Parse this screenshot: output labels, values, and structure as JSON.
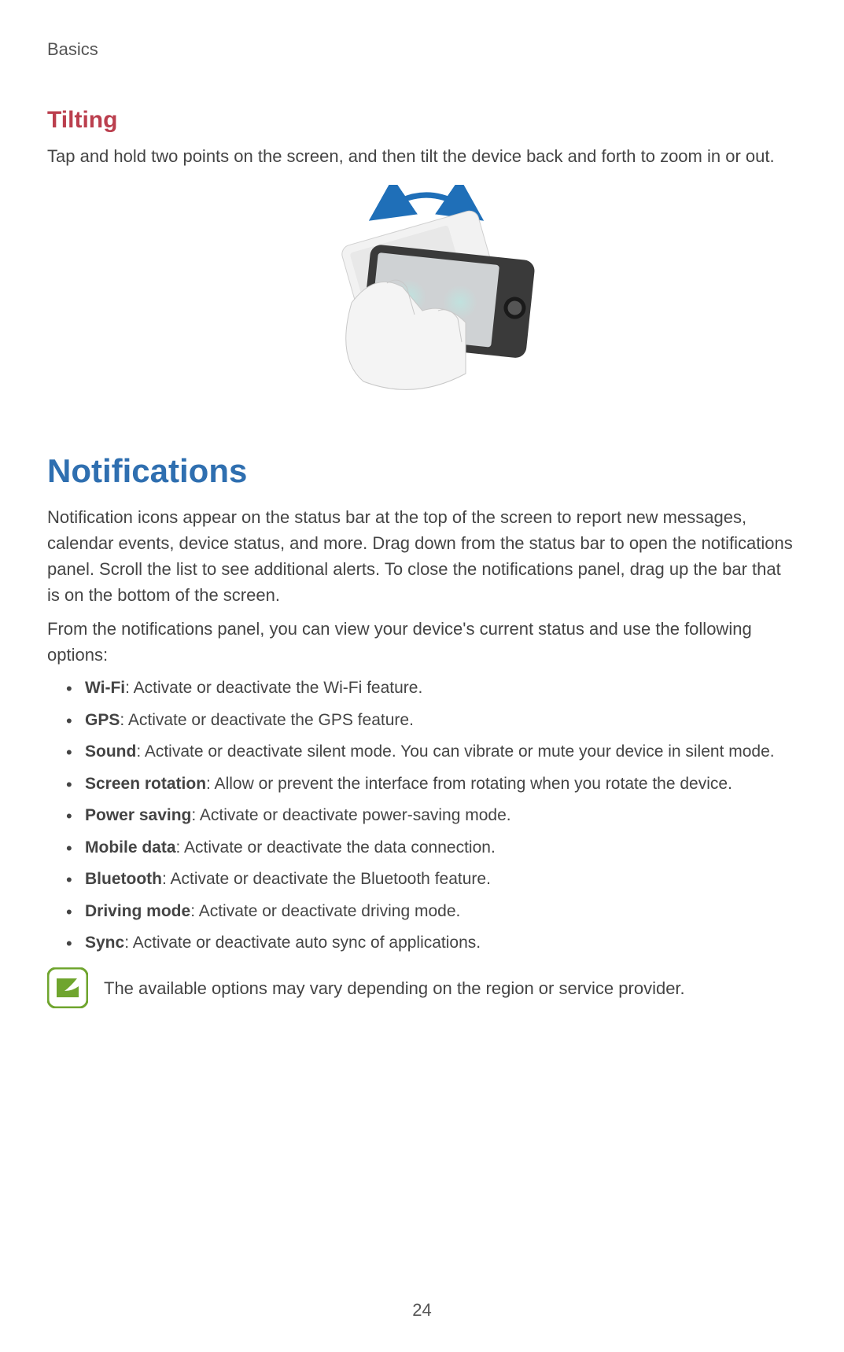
{
  "header": "Basics",
  "tilting": {
    "title": "Tilting",
    "body": "Tap and hold two points on the screen, and then tilt the device back and forth to zoom in or out."
  },
  "notifications": {
    "title": "Notifications",
    "para1": "Notification icons appear on the status bar at the top of the screen to report new messages, calendar events, device status, and more. Drag down from the status bar to open the notifications panel. Scroll the list to see additional alerts. To close the notifications panel, drag up the bar that is on the bottom of the screen.",
    "para2": "From the notifications panel, you can view your device's current status and use the following options:",
    "options": [
      {
        "term": "Wi-Fi",
        "desc": ": Activate or deactivate the Wi-Fi feature."
      },
      {
        "term": "GPS",
        "desc": ": Activate or deactivate the GPS feature."
      },
      {
        "term": "Sound",
        "desc": ": Activate or deactivate silent mode. You can vibrate or mute your device in silent mode."
      },
      {
        "term": "Screen rotation",
        "desc": ": Allow or prevent the interface from rotating when you rotate the device."
      },
      {
        "term": "Power saving",
        "desc": ": Activate or deactivate power-saving mode."
      },
      {
        "term": "Mobile data",
        "desc": ": Activate or deactivate the data connection."
      },
      {
        "term": "Bluetooth",
        "desc": ": Activate or deactivate the Bluetooth feature."
      },
      {
        "term": "Driving mode",
        "desc": ": Activate or deactivate driving mode."
      },
      {
        "term": "Sync",
        "desc": ": Activate or deactivate auto sync of applications."
      }
    ],
    "note": "The available options may vary depending on the region or service provider."
  },
  "page_number": "24"
}
